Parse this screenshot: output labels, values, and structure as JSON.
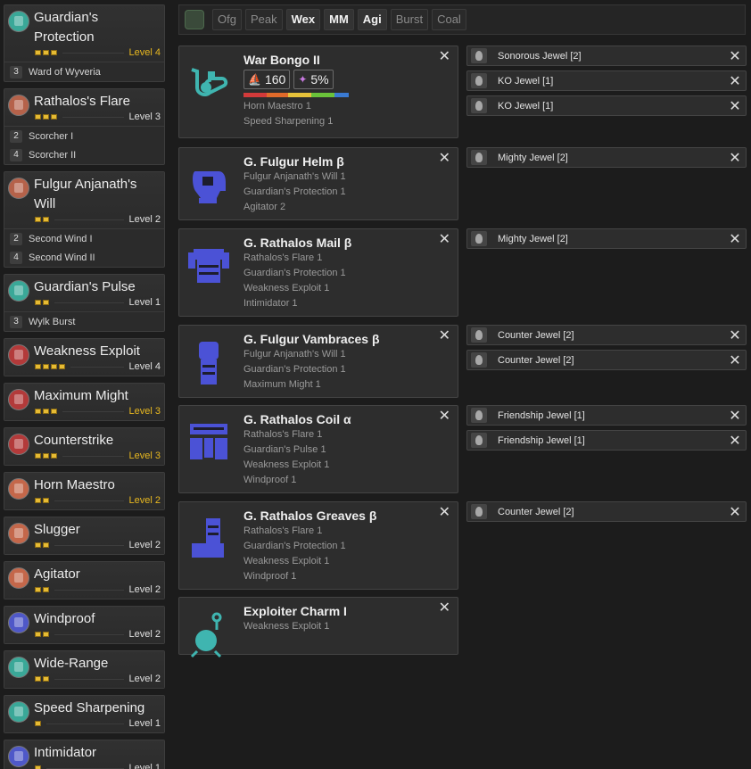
{
  "filters": [
    {
      "label": "Ofg",
      "active": false
    },
    {
      "label": "Peak",
      "active": false
    },
    {
      "label": "Wex",
      "active": true
    },
    {
      "label": "MM",
      "active": true
    },
    {
      "label": "Agi",
      "active": true
    },
    {
      "label": "Burst",
      "active": false
    },
    {
      "label": "Coal",
      "active": false
    }
  ],
  "skills": [
    {
      "name": "Guardian's Protection",
      "level": "Level 4",
      "max": true,
      "pips": 3,
      "icon_color": "#3aa898",
      "sets": [
        {
          "count": "3",
          "name": "Ward of Wyveria"
        }
      ]
    },
    {
      "name": "Rathalos's Flare",
      "level": "Level 3",
      "max": false,
      "pips": 3,
      "icon_color": "#b5624a",
      "sets": [
        {
          "count": "2",
          "name": "Scorcher I"
        },
        {
          "count": "4",
          "name": "Scorcher II"
        }
      ]
    },
    {
      "name": "Fulgur Anjanath's Will",
      "level": "Level 2",
      "max": false,
      "pips": 2,
      "icon_color": "#b5624a",
      "sets": [
        {
          "count": "2",
          "name": "Second Wind I"
        },
        {
          "count": "4",
          "name": "Second Wind II"
        }
      ]
    },
    {
      "name": "Guardian's Pulse",
      "level": "Level 1",
      "max": false,
      "pips": 2,
      "icon_color": "#3aa898",
      "sets": [
        {
          "count": "3",
          "name": "Wylk Burst"
        }
      ]
    },
    {
      "name": "Weakness Exploit",
      "level": "Level 4",
      "max": false,
      "pips": 4,
      "icon_color": "#b33a3a",
      "sets": []
    },
    {
      "name": "Maximum Might",
      "level": "Level 3",
      "max": true,
      "pips": 3,
      "icon_color": "#b33a3a",
      "sets": []
    },
    {
      "name": "Counterstrike",
      "level": "Level 3",
      "max": true,
      "pips": 3,
      "icon_color": "#b33a3a",
      "sets": []
    },
    {
      "name": "Horn Maestro",
      "level": "Level 2",
      "max": true,
      "pips": 2,
      "icon_color": "#c4674a",
      "sets": []
    },
    {
      "name": "Slugger",
      "level": "Level 2",
      "max": false,
      "pips": 2,
      "icon_color": "#c4674a",
      "sets": []
    },
    {
      "name": "Agitator",
      "level": "Level 2",
      "max": false,
      "pips": 2,
      "icon_color": "#c4674a",
      "sets": []
    },
    {
      "name": "Windproof",
      "level": "Level 2",
      "max": false,
      "pips": 2,
      "icon_color": "#4f58c8",
      "sets": []
    },
    {
      "name": "Wide-Range",
      "level": "Level 2",
      "max": false,
      "pips": 2,
      "icon_color": "#3aa898",
      "sets": []
    },
    {
      "name": "Speed Sharpening",
      "level": "Level 1",
      "max": false,
      "pips": 1,
      "icon_color": "#3aa898",
      "sets": []
    },
    {
      "name": "Intimidator",
      "level": "Level 1",
      "max": false,
      "pips": 1,
      "icon_color": "#4f58c8",
      "sets": []
    }
  ],
  "equipment": [
    {
      "name": "War Bongo II",
      "icon": "horn-icon",
      "icon_color": "#3fb5b0",
      "attack": "160",
      "affinity": "5%",
      "sharpness": [
        [
          "#d23a3a",
          20
        ],
        [
          "#e06a2a",
          18
        ],
        [
          "#e6c23a",
          20
        ],
        [
          "#6ac23a",
          20
        ],
        [
          "#3a7ad2",
          12
        ],
        [
          "#e6e6e6",
          0
        ]
      ],
      "skills": [
        "Horn Maestro 1",
        "Speed Sharpening 1"
      ],
      "jewels": [
        "Sonorous Jewel [2]",
        "KO Jewel [1]",
        "KO Jewel [1]"
      ]
    },
    {
      "name": "G. Fulgur Helm β",
      "icon": "helm-icon",
      "icon_color": "#4b52d6",
      "skills": [
        "Fulgur Anjanath's Will 1",
        "Guardian's Protection 1",
        "Agitator 2"
      ],
      "jewels": [
        "Mighty Jewel [2]"
      ]
    },
    {
      "name": "G. Rathalos Mail β",
      "icon": "chest-icon",
      "icon_color": "#4b52d6",
      "skills": [
        "Rathalos's Flare 1",
        "Guardian's Protection 1",
        "Weakness Exploit 1",
        "Intimidator 1"
      ],
      "jewels": [
        "Mighty Jewel [2]"
      ]
    },
    {
      "name": "G. Fulgur Vambraces β",
      "icon": "arms-icon",
      "icon_color": "#4b52d6",
      "skills": [
        "Fulgur Anjanath's Will 1",
        "Guardian's Protection 1",
        "Maximum Might 1"
      ],
      "jewels": [
        "Counter Jewel [2]",
        "Counter Jewel [2]"
      ]
    },
    {
      "name": "G. Rathalos Coil α",
      "icon": "waist-icon",
      "icon_color": "#4b52d6",
      "skills": [
        "Rathalos's Flare 1",
        "Guardian's Pulse 1",
        "Weakness Exploit 1",
        "Windproof 1"
      ],
      "jewels": [
        "Friendship Jewel [1]",
        "Friendship Jewel [1]"
      ]
    },
    {
      "name": "G. Rathalos Greaves β",
      "icon": "legs-icon",
      "icon_color": "#4b52d6",
      "skills": [
        "Rathalos's Flare 1",
        "Guardian's Protection 1",
        "Weakness Exploit 1",
        "Windproof 1"
      ],
      "jewels": [
        "Counter Jewel [2]"
      ]
    },
    {
      "name": "Exploiter Charm I",
      "icon": "charm-icon",
      "icon_color": "#3fb5b0",
      "skills": [
        "Weakness Exploit 1"
      ],
      "jewels": []
    }
  ]
}
